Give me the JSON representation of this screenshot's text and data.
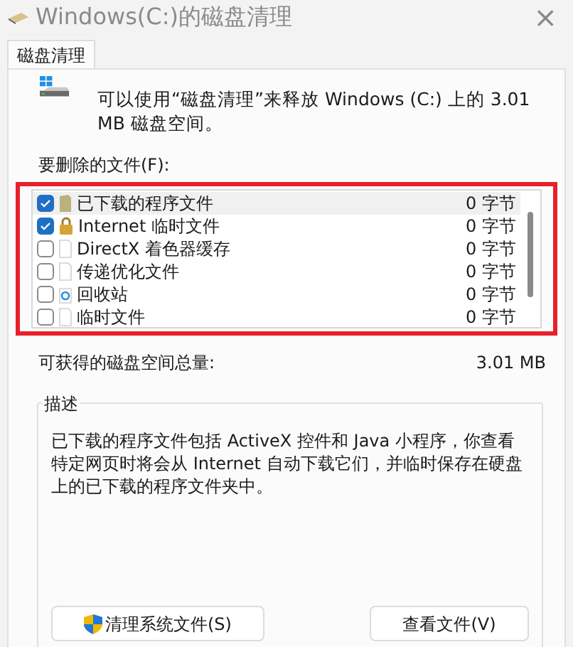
{
  "window": {
    "title": "Windows(C:)的磁盘清理",
    "close": "×"
  },
  "tabs": [
    {
      "label": "磁盘清理",
      "selected": true
    }
  ],
  "intro": "可以使用“磁盘清理”来释放 Windows (C:) 上的 3.01 MB 磁盘空间。",
  "files_label": "要删除的文件(F):",
  "files": [
    {
      "name": "已下载的程序文件",
      "size": "0 字节",
      "checked": true,
      "selected": true,
      "kind": "folder"
    },
    {
      "name": "Internet 临时文件",
      "size": "0 字节",
      "checked": true,
      "selected": false,
      "kind": "lock"
    },
    {
      "name": "DirectX 着色器缓存",
      "size": "0 字节",
      "checked": false,
      "selected": false,
      "kind": "file"
    },
    {
      "name": "传递优化文件",
      "size": "0 字节",
      "checked": false,
      "selected": false,
      "kind": "file"
    },
    {
      "name": "回收站",
      "size": "0 字节",
      "checked": false,
      "selected": false,
      "kind": "recycle"
    },
    {
      "name": "临时文件",
      "size": "0 字节",
      "checked": false,
      "selected": false,
      "kind": "file"
    }
  ],
  "total": {
    "label": "可获得的磁盘空间总量:",
    "value": "3.01 MB"
  },
  "description": {
    "title": "描述",
    "text": "已下载的程序文件包括 ActiveX 控件和 Java 小程序，你查看特定网页时将会从 Internet 自动下载它们，并临时保存在硬盘上的已下载的程序文件夹中。"
  },
  "buttons": [
    {
      "label": "清理系统文件(S)",
      "kind": "shield"
    },
    {
      "label": "查看文件(V)",
      "kind": "plain"
    }
  ]
}
